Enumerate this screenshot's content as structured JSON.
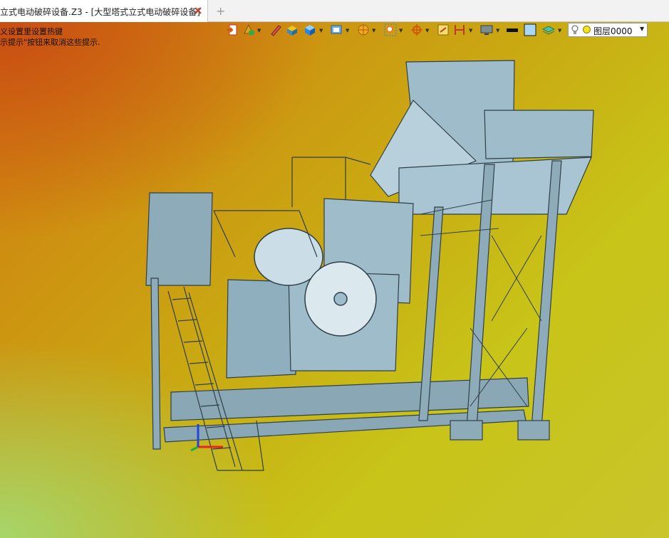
{
  "tab": {
    "title": "立式电动破碎设备.Z3 - [大型塔式立式电动破碎设备]",
    "close_icon": "close-icon",
    "new_tab_symbol": "+"
  },
  "hints": [
    "义设置里设置热键",
    "示提示\"按钮来取消这些提示."
  ],
  "toolbar": {
    "icons": [
      "extract-icon",
      "shape-style-icon",
      "pen-icon",
      "material-icon",
      "cube-view-icon",
      "render-mode-icon",
      "section-view-icon",
      "zoom-region-icon",
      "coordinate-icon",
      "frame-icon",
      "dimension-icon",
      "display-icon",
      "line-icon",
      "color-fill-icon",
      "layer-stack-icon"
    ],
    "layer": {
      "value": "图层0000",
      "bulb_icon": "lightbulb-icon",
      "status_color": "#f4e21b"
    }
  },
  "viewport": {
    "background_colors": [
      "#c94d12",
      "#d27a10",
      "#c9c52b",
      "#a6d66a"
    ],
    "model_color": "#8fb1c4",
    "axis_colors": {
      "x": "#e8261c",
      "y": "#22b03a",
      "z": "#2346d8"
    }
  }
}
